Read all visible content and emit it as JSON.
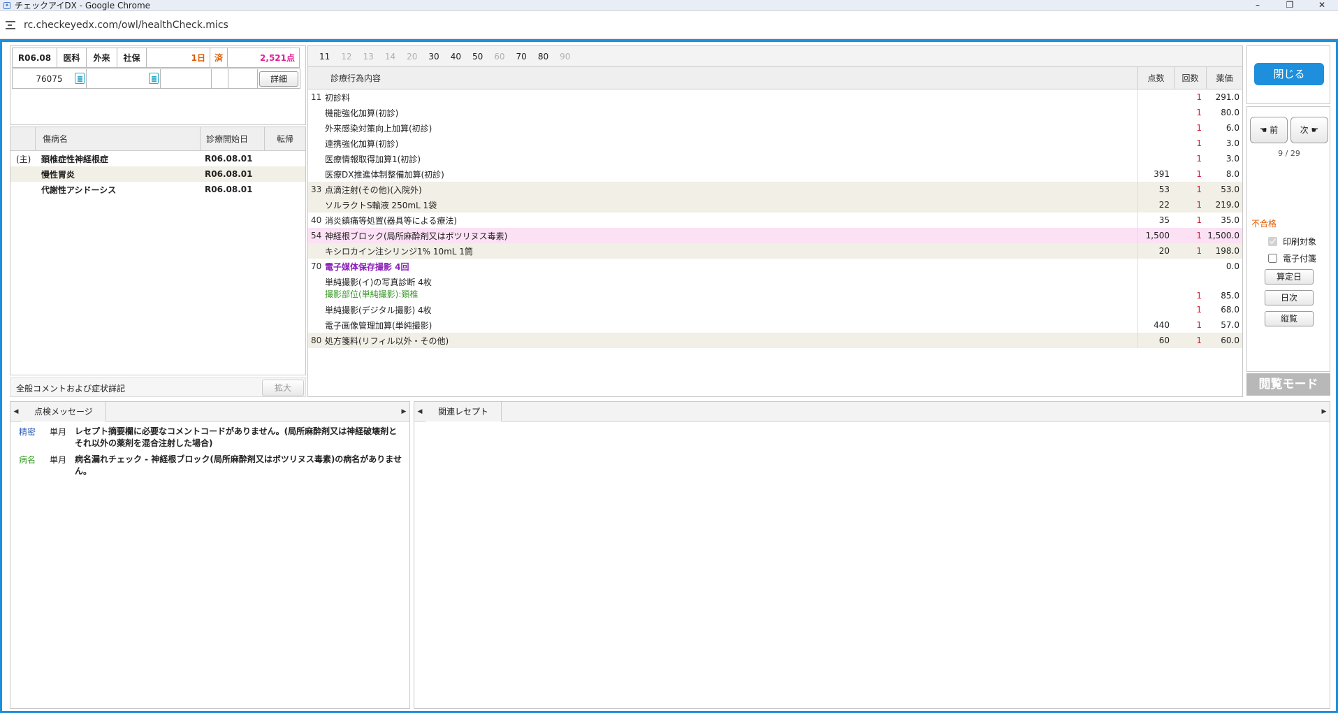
{
  "browser": {
    "window_title": "チェックアイDX - Google Chrome",
    "url": "rc.checkeyedx.com/owl/healthCheck.mics",
    "min": "–",
    "max": "❐",
    "close": "✕"
  },
  "receipt": {
    "month": "R06.08",
    "dept": "医科",
    "visit": "外来",
    "insurance": "社保",
    "days": "1日",
    "status": "済",
    "points": "2,521点",
    "patient_id": "76075",
    "detail_button": "詳細"
  },
  "disease_table": {
    "headers": [
      "傷病名",
      "診療開始日",
      "転帰"
    ],
    "rows": [
      {
        "prefix": "(主)",
        "name": "頚椎症性神経根症",
        "date": "R06.08.01",
        "outcome": ""
      },
      {
        "prefix": "",
        "name": "慢性胃炎",
        "date": "R06.08.01",
        "outcome": ""
      },
      {
        "prefix": "",
        "name": "代謝性アシドーシス",
        "date": "R06.08.01",
        "outcome": ""
      }
    ]
  },
  "comment_section": {
    "label": "全般コメントおよび症状詳記",
    "expand_button": "拡大"
  },
  "category_tabs": [
    {
      "label": "11",
      "active": true
    },
    {
      "label": "12",
      "active": false
    },
    {
      "label": "13",
      "active": false
    },
    {
      "label": "14",
      "active": false
    },
    {
      "label": "20",
      "active": false
    },
    {
      "label": "30",
      "active": true
    },
    {
      "label": "40",
      "active": true
    },
    {
      "label": "50",
      "active": true
    },
    {
      "label": "60",
      "active": false
    },
    {
      "label": "70",
      "active": true
    },
    {
      "label": "80",
      "active": true
    },
    {
      "label": "90",
      "active": false
    }
  ],
  "treatment_table": {
    "headers": {
      "name": "診療行為内容",
      "points": "点数",
      "count": "回数",
      "price": "薬価"
    },
    "rows": [
      {
        "code": "11",
        "name": "初診料",
        "points": "",
        "count": "1",
        "amount": "291.0",
        "style": ""
      },
      {
        "code": "",
        "name": "機能強化加算(初診)",
        "points": "",
        "count": "1",
        "amount": "80.0",
        "style": ""
      },
      {
        "code": "",
        "name": "外来感染対策向上加算(初診)",
        "points": "",
        "count": "1",
        "amount": "6.0",
        "style": ""
      },
      {
        "code": "",
        "name": "連携強化加算(初診)",
        "points": "",
        "count": "1",
        "amount": "3.0",
        "style": ""
      },
      {
        "code": "",
        "name": "医療情報取得加算1(初診)",
        "points": "",
        "count": "1",
        "amount": "3.0",
        "style": ""
      },
      {
        "code": "",
        "name": "医療DX推進体制整備加算(初診)",
        "points": "391",
        "count": "1",
        "amount": "8.0",
        "style": ""
      },
      {
        "code": "33",
        "name": "点滴注射(その他)(入院外)",
        "points": "53",
        "count": "1",
        "amount": "53.0",
        "style": "alt"
      },
      {
        "code": "",
        "name": "ソルラクトS輸液 250mL 1袋",
        "points": "22",
        "count": "1",
        "amount": "219.0",
        "style": "alt"
      },
      {
        "code": "40",
        "name": "消炎鎮痛等処置(器具等による療法)",
        "points": "35",
        "count": "1",
        "amount": "35.0",
        "style": ""
      },
      {
        "code": "54",
        "name": "神経根ブロック(局所麻酔剤又はボツリヌス毒素)",
        "points": "1,500",
        "count": "1",
        "amount": "1,500.0",
        "style": "hl"
      },
      {
        "code": "",
        "name": "キシロカイン注シリンジ1% 10mL 1筒",
        "points": "20",
        "count": "1",
        "amount": "198.0",
        "style": "alt"
      },
      {
        "code": "70",
        "name": "電子媒体保存撮影  4回",
        "points": "",
        "count": "",
        "amount": "0.0",
        "style": "purple"
      },
      {
        "code": "",
        "name": "単純撮影(イ)の写真診断 4枚",
        "points": "",
        "count": "",
        "amount": "",
        "style": "tall",
        "sub": "撮影部位(単純撮影):頚椎",
        "sub_count": "1",
        "sub_amount": "85.0"
      },
      {
        "code": "",
        "name": "単純撮影(デジタル撮影) 4枚",
        "points": "",
        "count": "1",
        "amount": "68.0",
        "style": ""
      },
      {
        "code": "",
        "name": "電子画像管理加算(単純撮影)",
        "points": "440",
        "count": "1",
        "amount": "57.0",
        "style": ""
      },
      {
        "code": "80",
        "name": "処方箋料(リフィル以外・その他)",
        "points": "60",
        "count": "1",
        "amount": "60.0",
        "style": "alt"
      }
    ]
  },
  "right_panel": {
    "close_button": "閉じる",
    "prev_button": "前",
    "next_button": "次",
    "pager": "9 / 29",
    "result": "不合格",
    "print_target_label": "印刷対象",
    "print_target_checked": true,
    "e_attach_label": "電子付箋",
    "e_attach_checked": false,
    "calc_day_button": "算定日",
    "daily_button": "日次",
    "vertical_button": "縦覧",
    "mode_label": "閲覧モード"
  },
  "check_messages": {
    "tab": "点検メッセージ",
    "messages": [
      {
        "kind": "精密",
        "kind_color": "#2a5db0",
        "period": "単月",
        "text": "レセプト摘要欄に必要なコメントコードがありません。(局所麻酔剤又は神経破壊剤とそれ以外の薬剤を混合注射した場合)"
      },
      {
        "kind": "病名",
        "kind_color": "#3a9a2a",
        "period": "単月",
        "text": "病名漏れチェック - 神経根ブロック(局所麻酔剤又はボツリヌス毒素)の病名がありません。"
      }
    ]
  },
  "related_receipt": {
    "tab": "関連レセプト"
  }
}
